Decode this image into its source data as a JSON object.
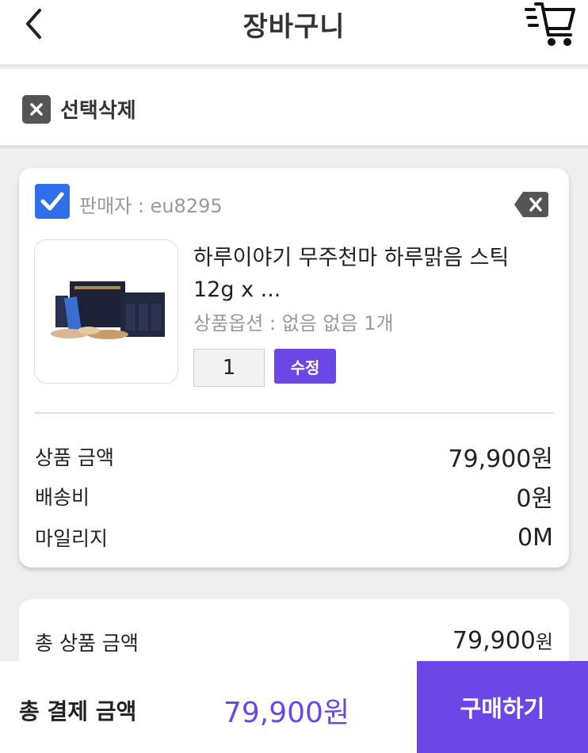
{
  "header": {
    "title": "장바구니"
  },
  "select_bar": {
    "delete_label": "선택삭제"
  },
  "cart_item": {
    "seller": "판매자 : eu8295",
    "name": "하루이야기 무주천마 하루맑음 스틱 12g x ...",
    "option": "상품옵션 : 없음 없음 1개",
    "quantity": "1",
    "edit_label": "수정",
    "price_label": "상품 금액",
    "price_value": "79,900원",
    "shipping_label": "배송비",
    "shipping_value": "0원",
    "mileage_label": "마일리지",
    "mileage_value": "0M"
  },
  "summary": {
    "total_label": "총 상품 금액",
    "total_number": "79,900",
    "total_unit": "원"
  },
  "footer": {
    "pay_label": "총 결제 금액",
    "pay_value": "79,900원",
    "buy_label": "구매하기"
  },
  "colors": {
    "accent": "#6c47e6",
    "checkbox": "#2f6ee8"
  }
}
